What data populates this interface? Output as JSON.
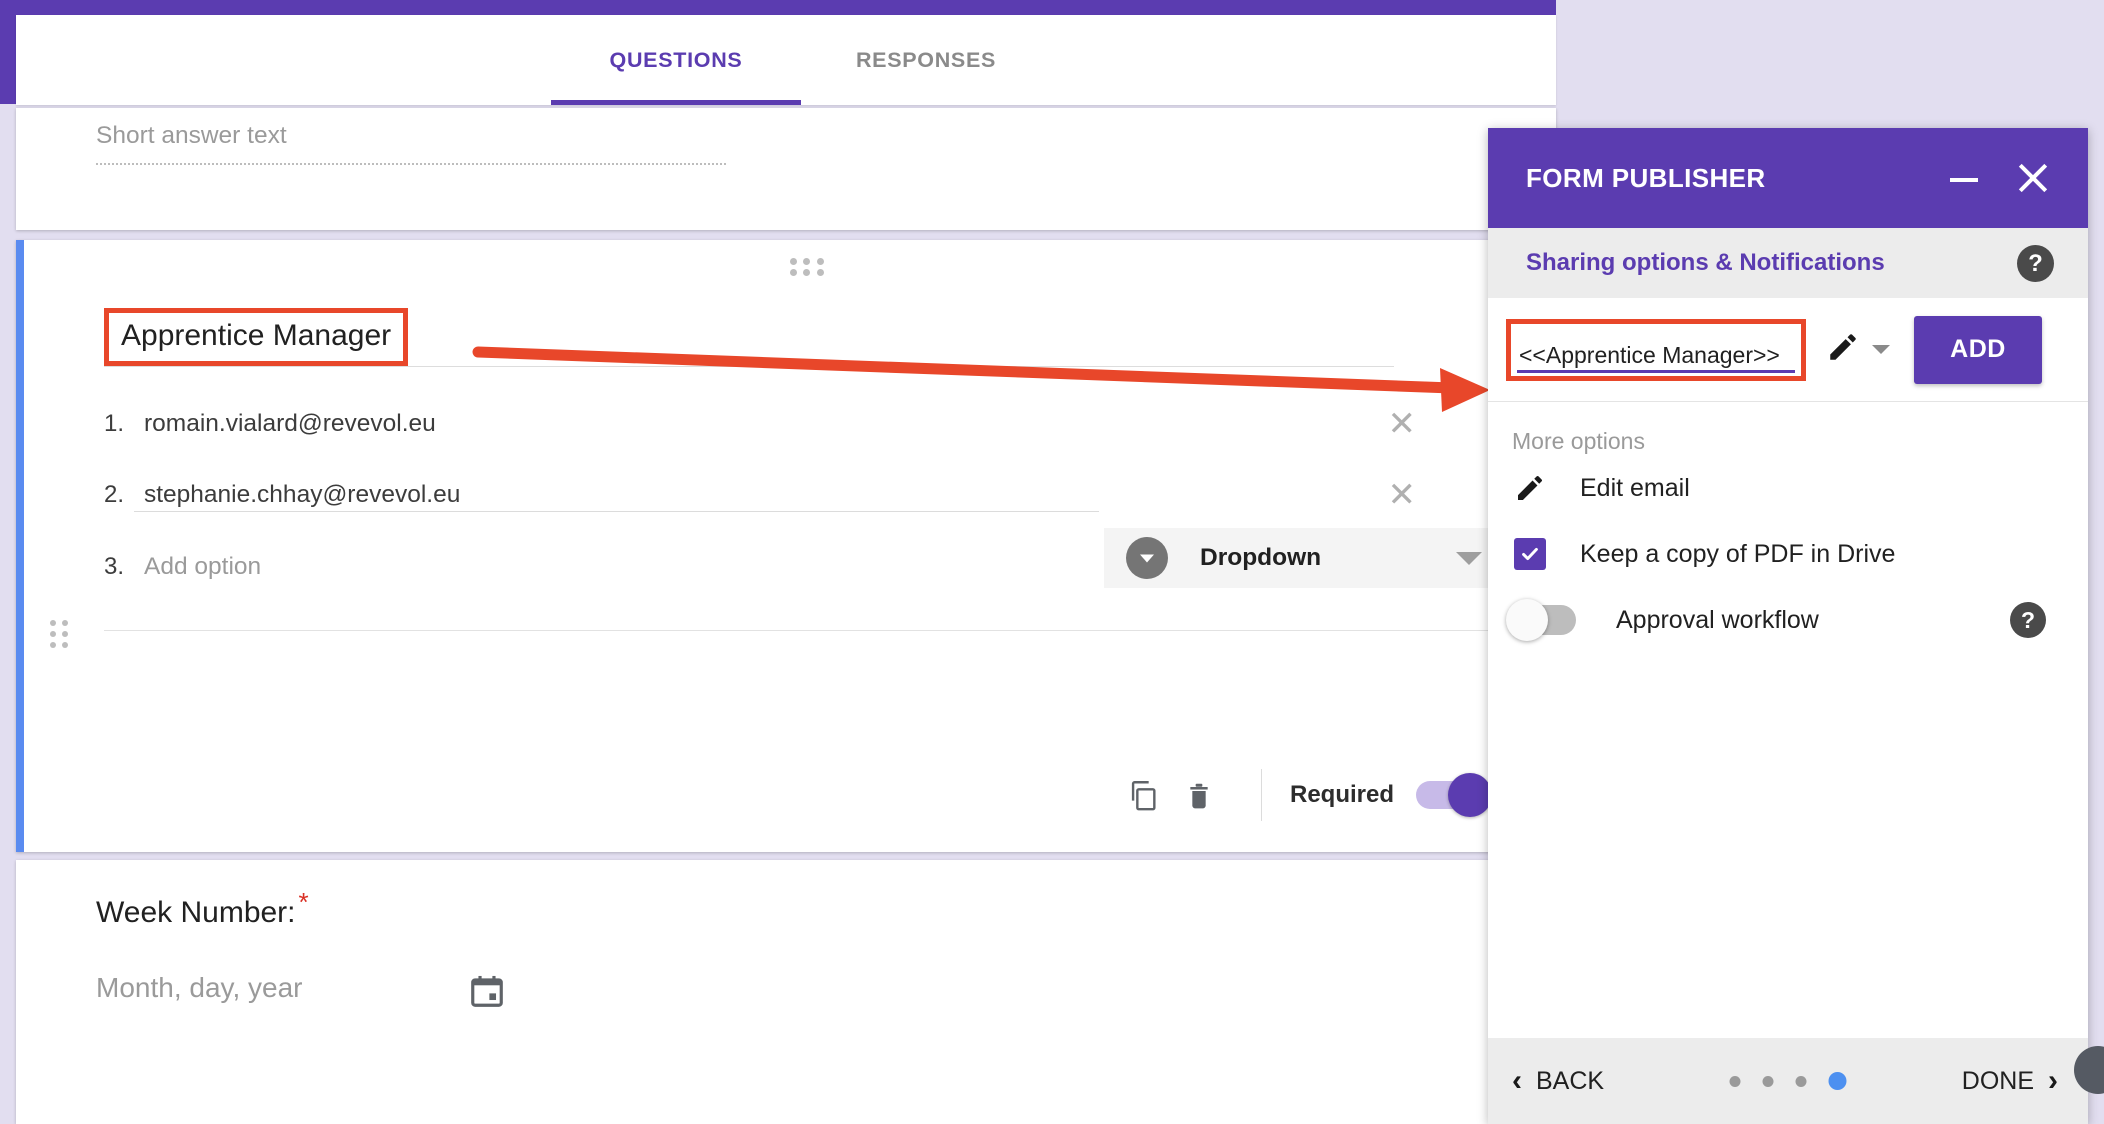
{
  "colors": {
    "brand_purple": "#5b3cb0",
    "annotation_red": "#e8472a",
    "active_card_blue": "#5a8bf0",
    "page_bg": "#e2def0",
    "dot_active_blue": "#4d90f0"
  },
  "form": {
    "tabs": [
      {
        "label": "QUESTIONS",
        "active": true
      },
      {
        "label": "RESPONSES",
        "active": false
      }
    ],
    "short_answer_card": {
      "placeholder": "Short answer text"
    },
    "question_card": {
      "title": "Apprentice Manager",
      "type_selector": {
        "label": "Dropdown",
        "icon": "dropdown-circle-icon",
        "caret": "chevron-down-icon"
      },
      "options": [
        {
          "num": "1.",
          "text": "romain.vialard@revevol.eu",
          "is_placeholder": false
        },
        {
          "num": "2.",
          "text": "stephanie.chhay@revevol.eu",
          "is_placeholder": false
        },
        {
          "num": "3.",
          "text": "Add option",
          "is_placeholder": true
        }
      ],
      "footer": {
        "duplicate_icon": "duplicate-icon",
        "delete_icon": "trash-icon",
        "required_label": "Required",
        "required_on": true
      }
    },
    "week_card": {
      "title": "Week Number:",
      "required_marker": "*",
      "date_placeholder": "Month, day, year",
      "calendar_icon": "calendar-icon"
    }
  },
  "form_publisher": {
    "title": "FORM PUBLISHER",
    "minimize_icon": "minimize-icon",
    "close_icon": "close-icon",
    "subtitle": "Sharing options & Notifications",
    "help_icon": "help-icon",
    "help_glyph": "?",
    "field": {
      "value": "<<Apprentice Manager>>",
      "pencil_icon": "pencil-icon",
      "caret_icon": "chevron-down-icon"
    },
    "add_button": "ADD",
    "more_options_label": "More options",
    "options": [
      {
        "label": "Edit email",
        "control": "pencil-icon"
      },
      {
        "label": "Keep a copy of PDF in Drive",
        "control": "checkbox-checked"
      },
      {
        "label": "Approval workflow",
        "control": "toggle-off",
        "help": "?"
      }
    ],
    "footer": {
      "back_label": "BACK",
      "back_chevron": "‹",
      "done_label": "DONE",
      "done_chevron": "›",
      "steps_total": 4,
      "step_active_index": 3
    }
  }
}
